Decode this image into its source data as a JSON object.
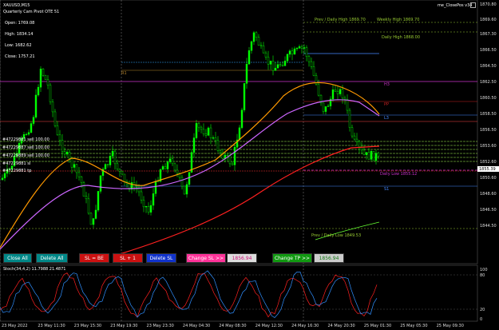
{
  "header": {
    "symbol": "XAUUSD,M15",
    "ea": "me_ClosePos v34",
    "quarterly": "Quarterly Cam Pivot OTE 51"
  },
  "info_box": {
    "open": "Open: 1769.08",
    "high": "High: 1834.14",
    "low": "Low: 1682.62",
    "close": "Close: 1757.21"
  },
  "levels": {
    "prev_daily_high": "Prev / Daily High 1869.70",
    "weekly_high": "Weekly High 1869.70",
    "daily_high": "Daily High 1868.00",
    "h3": "H3",
    "pp": "PP",
    "l3": "L3",
    "r1": "R1",
    "s1": "S1",
    "daily_low": "Daily Low 1855.12",
    "prev_daily_low": "Prev / Daily Low 1849.53"
  },
  "order_labels": [
    "#47229881 sell 100.00",
    "#47229887 sell 100.00",
    "#47229889 sell 100.00",
    "#47229881 sl",
    "#47229881 tp"
  ],
  "buttons": {
    "close_all": "Close All",
    "delete_all": "Delete All",
    "sl_be": "SL = BE",
    "sl_plus1": "SL + 1",
    "delete_sl": "Delete SL",
    "change_sl": "Change SL >>",
    "sl_value": "1856.94",
    "change_tp": "Change TP >>",
    "tp_value": "1856.94"
  },
  "price_axis": [
    "1870.80",
    "1869.60",
    "1867.30",
    "1866.50",
    "1864.50",
    "1862.50",
    "1860.50",
    "1858.50",
    "1856.50",
    "1855.39",
    "1853.60",
    "1852.60",
    "1850.60",
    "1848.60",
    "1846.50",
    "1844.50"
  ],
  "current_price": "1855.39",
  "stoch": {
    "label": "Stoch(34,4,2) 11.7988 21.4871",
    "axis": [
      "100",
      "80",
      "20",
      "0"
    ]
  },
  "time_axis": [
    "23 May 2022",
    "23 May 11:30",
    "23 May 15:30",
    "23 May 19:30",
    "23 May 23:30",
    "24 May 04:30",
    "24 May 08:30",
    "24 May 12:30",
    "24 May 16:30",
    "24 May 20:30",
    "25 May 01:30",
    "25 May 05:30",
    "25 May 09:30"
  ],
  "colors": {
    "bull": "#00ff00",
    "ma_orange": "#ff9900",
    "ma_violet": "#cc66ff",
    "ma_red": "#ff2020",
    "level_magenta": "#cc33cc",
    "level_blue": "#4488ff",
    "level_green": "#99cc33"
  }
}
